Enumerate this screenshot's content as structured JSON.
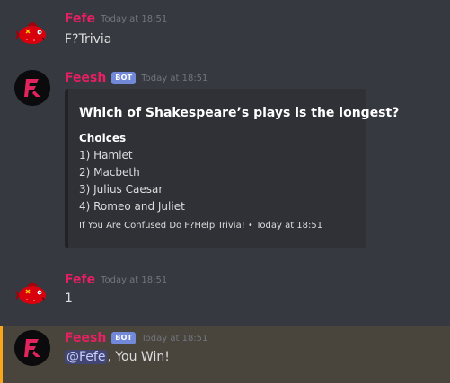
{
  "colors": {
    "background": "#36393f",
    "fefe_name": "#e91e63",
    "feesh_name": "#e91e63",
    "bot_tag": "#7289da",
    "embed_bg": "#2f3136",
    "mention_bg": "#414675",
    "highlight_bg": "#49443c",
    "highlight_border": "#faa61a"
  },
  "messages": [
    {
      "author": "Fefe",
      "avatar": "red-fish-icon",
      "timestamp": "Today at 18:51",
      "content": "F?Trivia"
    },
    {
      "author": "Feesh",
      "bot_tag": "BOT",
      "avatar": "feesh-logo-icon",
      "timestamp": "Today at 18:51",
      "embed": {
        "title": "Which of Shakespeare’s plays is the longest?",
        "field_name": "Choices",
        "choices": [
          "1) Hamlet",
          "2) Macbeth",
          "3) Julius Caesar",
          "4) Romeo and Juliet"
        ],
        "footer": "If You Are Confused Do F?Help Trivia! • Today at 18:51"
      }
    },
    {
      "author": "Fefe",
      "avatar": "red-fish-icon",
      "timestamp": "Today at 18:51",
      "content": "1"
    },
    {
      "author": "Feesh",
      "bot_tag": "BOT",
      "avatar": "feesh-logo-icon",
      "timestamp": "Today at 18:51",
      "mention": "@Fefe",
      "content_after_mention": ", You Win!"
    }
  ]
}
